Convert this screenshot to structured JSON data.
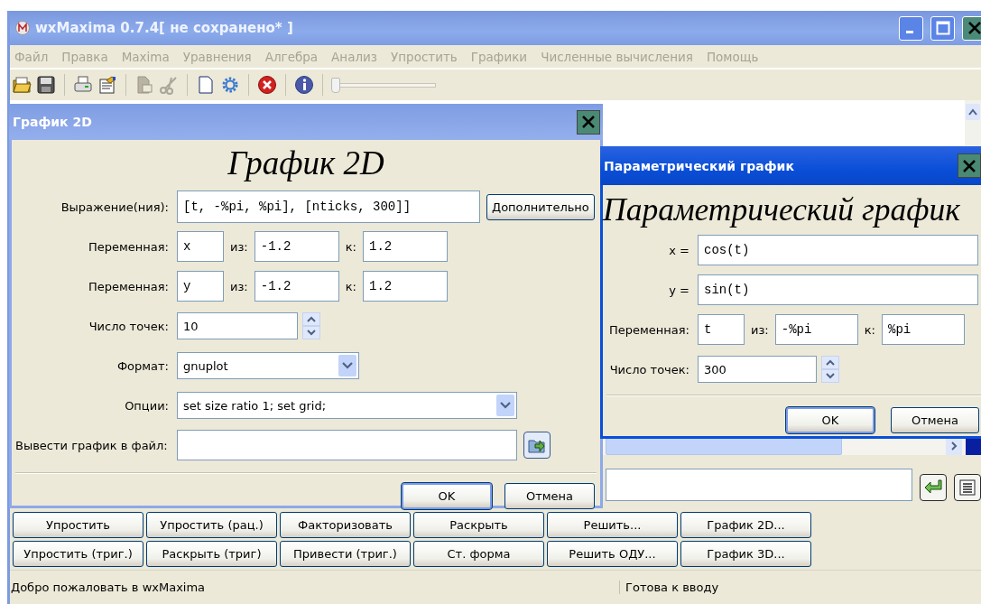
{
  "window": {
    "title": "wxMaxima 0.7.4[ не сохранено* ]"
  },
  "menu": [
    "Файл",
    "Правка",
    "Maxima",
    "Уравнения",
    "Алгебра",
    "Анализ",
    "Упростить",
    "Графики",
    "Численные вычисления",
    "Помощь"
  ],
  "toolbar": {
    "slider": {
      "level": 0
    }
  },
  "command_buttons": [
    [
      "Упростить",
      "Упростить (рац.)",
      "Факторизовать",
      "Раскрыть",
      "Решить...",
      "График 2D..."
    ],
    [
      "Упростить (триг.)",
      "Раскрыть (триг)",
      "Привести (триг.)",
      "Ст. форма",
      "Решить ОДУ...",
      "График 3D..."
    ]
  ],
  "status_bar": [
    "Добро пожаловать в wxMaxima",
    "Готова к вводу"
  ],
  "plot2d_dialog": {
    "title": "График 2D",
    "heading": "График 2D",
    "expression": {
      "label": "Выражение(ния):",
      "value": "[t, -%pi, %pi], [nticks, 300]]"
    },
    "more_button": "Дополнительно",
    "variables": [
      {
        "label": "Переменная:",
        "name": "x",
        "from_label": "из:",
        "from": "-1.2",
        "to_label": "к:",
        "to": "1.2"
      },
      {
        "label": "Переменная:",
        "name": "y",
        "from_label": "из:",
        "from": "-1.2",
        "to_label": "к:",
        "to": "1.2"
      }
    ],
    "points": {
      "label": "Число точек:",
      "value": "10"
    },
    "format": {
      "label": "Формат:",
      "value": "gnuplot"
    },
    "options": {
      "label": "Опции:",
      "value": "set size ratio 1; set grid;"
    },
    "file": {
      "label": "Вывести график в файл:"
    },
    "buttons": [
      "OK",
      "Отмена"
    ]
  },
  "parametric_dialog": {
    "title": "Параметрический график",
    "heading": "Параметрический график",
    "x": {
      "label": "x =",
      "value": "cos(t)"
    },
    "y": {
      "label": "y =",
      "value": "sin(t)"
    },
    "variable": {
      "label": "Переменная:",
      "name": "t",
      "from_label": "из:",
      "from": "-%pi",
      "to_label": "к:",
      "to": "%pi"
    },
    "points": {
      "label": "Число точек:",
      "value": "300"
    },
    "buttons": [
      "OK",
      "Отмена"
    ]
  }
}
